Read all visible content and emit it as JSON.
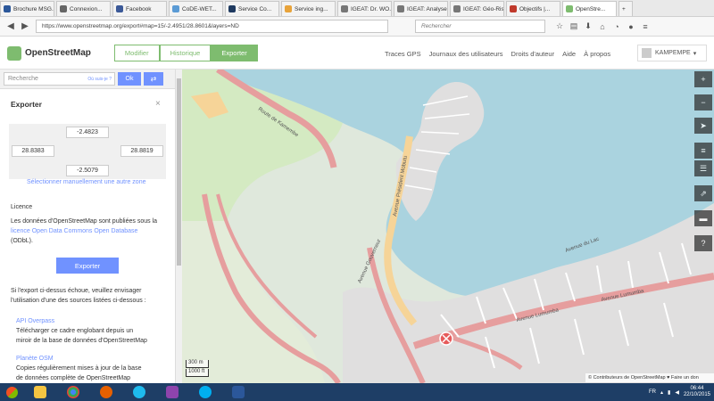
{
  "browser": {
    "tabs": [
      {
        "label": "Brochure MSG...",
        "color": "#2b579a"
      },
      {
        "label": "Connexion...",
        "color": "#666666"
      },
      {
        "label": "Facebook",
        "color": "#3b5998"
      },
      {
        "label": "CoDE-WET...",
        "color": "#5b9bd5"
      },
      {
        "label": "Service Co...",
        "color": "#1f3a60"
      },
      {
        "label": "Service ing...",
        "color": "#e8a33a"
      },
      {
        "label": "IGEAT: Dr. WO...",
        "color": "#777777"
      },
      {
        "label": "IGEAT: Analyse...",
        "color": "#777777"
      },
      {
        "label": "IGEAT: Géo-Ris...",
        "color": "#777777"
      },
      {
        "label": "Objectifs |...",
        "color": "#c0392b"
      },
      {
        "label": "OpenStre...",
        "color": "#7ebc6f"
      }
    ],
    "url": "https://www.openstreetmap.org/export#map=15/-2.4951/28.8601&layers=ND",
    "search_placeholder": "Rechercher"
  },
  "osm": {
    "brand": "OpenStreetMap",
    "buttons": {
      "edit": "Modifier",
      "history": "Historique",
      "export": "Exporter"
    },
    "links": [
      "Traces GPS",
      "Journaux des utilisateurs",
      "Droits d'auteur",
      "Aide",
      "À propos"
    ],
    "user": "KAMPEMPE"
  },
  "sidebar": {
    "search_placeholder": "Recherche",
    "where_link": "Où suis-je ?",
    "ok_label": "Ok",
    "directions_icon": "directions-icon",
    "panel_title": "Exporter",
    "close_label": "×",
    "bbox": {
      "north": "-2.4823",
      "west": "28.8383",
      "east": "28.8819",
      "south": "-2.5079"
    },
    "select_manually": "Sélectionner manuellement une autre zone",
    "licence_heading": "Licence",
    "licence_text_1": "Les données d'OpenStreetMap sont publiées sous la",
    "licence_link": "licence Open Data Commons Open Database",
    "licence_text_2": "(ODbL).",
    "export_button": "Exporter",
    "fallback_1": "Si l'export ci-dessus échoue, veuillez envisager",
    "fallback_2": "l'utilisation d'une des sources listées ci-dessous :",
    "source1_title": "API Overpass",
    "source1_l1": "Télécharger ce cadre englobant depuis un",
    "source1_l2": "miroir de la base de données d'OpenStreetMap",
    "source2_title": "Planète OSM",
    "source2_l1": "Copies régulièrement mises à jour de la base",
    "source2_l2": "de données complète de OpenStreetMap"
  },
  "map": {
    "controls": [
      "+",
      "−",
      "➤",
      "≡",
      "☰",
      "⇗",
      "▬",
      "?"
    ],
    "scale_metric": "300 m",
    "scale_imperial": "1000 ft",
    "attribution": "© Contributeurs de OpenStreetMap ♥ Faire un don",
    "colors": {
      "water": "#aad3df",
      "land": "#dfe8dc",
      "urban": "#e0dfdf",
      "road": "#e69e9e",
      "yellow": "#f6d498",
      "green": "#cdebb0"
    },
    "street_labels": [
      "Route de Kamembe",
      "Avenue Président Mobutu",
      "Avenue Lumumba",
      "Avenue Lumumba",
      "Avenue Gouverneur",
      "Avenue du Lac"
    ]
  },
  "taskbar": {
    "items": [
      "explorer",
      "chrome",
      "firefox",
      "ie",
      "winrar",
      "skype",
      "word"
    ],
    "lang": "FR",
    "time": "06:44",
    "date": "22/10/2015"
  }
}
